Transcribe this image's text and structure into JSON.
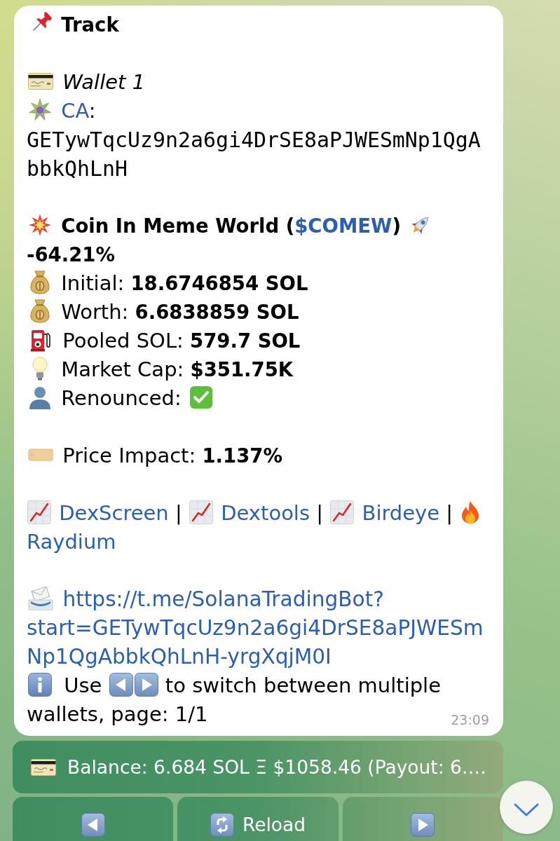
{
  "message": {
    "title": "Track",
    "wallet": "Wallet 1",
    "contract": {
      "label": "CA",
      "suffix": ":",
      "address": "GETywTqcUz9n2a6gi4DrSE8aPJWESmNp1QgAbbkQhLnH"
    },
    "token": {
      "name_prefix": "Coin In Meme World (",
      "symbol": "$COMEW",
      "name_suffix": ")",
      "change": "-64.21%"
    },
    "initial": {
      "label": "Initial:",
      "value": "18.6746854 SOL"
    },
    "worth": {
      "label": "Worth:",
      "value": "6.6838859 SOL"
    },
    "pooled": {
      "label": "Pooled SOL:",
      "value": "579.7 SOL"
    },
    "market_cap": {
      "label": "Market Cap:",
      "value": "$351.75K"
    },
    "renounced": {
      "label": "Renounced:",
      "checked": true
    },
    "price_impact": {
      "label": "Price Impact:",
      "value": "1.137%"
    },
    "links": [
      {
        "kind": "chart",
        "label": "DexScreen",
        "separator": "|"
      },
      {
        "kind": "chart",
        "label": "Dextools",
        "separator": "|"
      },
      {
        "kind": "chart",
        "label": "Birdeye",
        "separator": "|"
      },
      {
        "kind": "fire",
        "label": "Raydium"
      }
    ],
    "share_link": "https://t.me/SolanaTradingBot?start=GETywTqcUz9n2a6gi4DrSE8aPJWESmNp1QgAbbkQhLnH-yrgXqjM0I",
    "hint": {
      "before": "Use",
      "after": "to switch between multiple wallets, page: 1/1"
    },
    "time": "23:09"
  },
  "keyboard": [
    [
      {
        "kind": "balance",
        "label": "Balance: 6.684 SOL Ξ $1058.46 (Payout: 6.…"
      }
    ],
    [
      {
        "kind": "previous"
      },
      {
        "kind": "reload",
        "label": "Reload"
      },
      {
        "kind": "next"
      }
    ]
  ]
}
